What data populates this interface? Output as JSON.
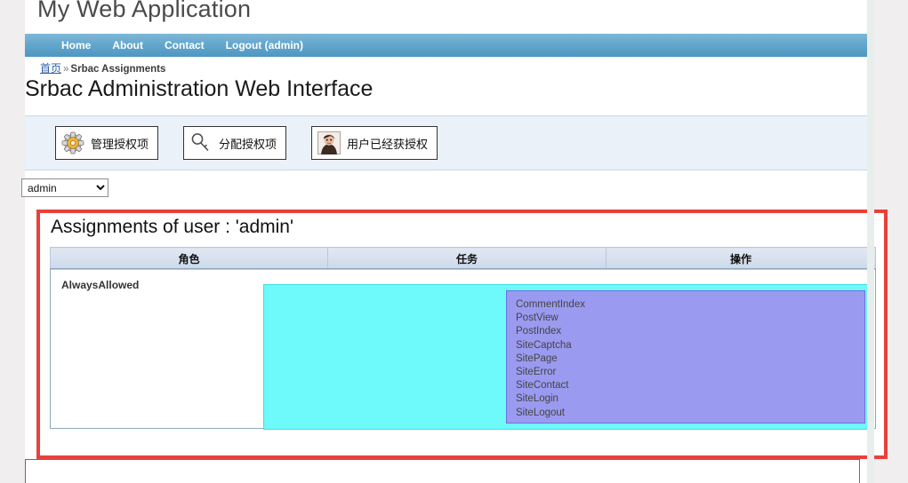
{
  "app": {
    "title": "My Web Application"
  },
  "nav": {
    "items": [
      {
        "label": "Home",
        "name": "nav-home"
      },
      {
        "label": "About",
        "name": "nav-about"
      },
      {
        "label": "Contact",
        "name": "nav-contact"
      },
      {
        "label": "Logout (admin)",
        "name": "nav-logout"
      }
    ]
  },
  "breadcrumb": {
    "home_label": "首页",
    "separator": "»",
    "current": "Srbac Assignments"
  },
  "page": {
    "heading": "Srbac Administration Web Interface"
  },
  "toolbar": {
    "buttons": [
      {
        "label": "管理授权项",
        "icon": "gear-icon"
      },
      {
        "label": "分配授权项",
        "icon": "key-icon"
      },
      {
        "label": "用户已经获授权",
        "icon": "user-photo-icon"
      }
    ]
  },
  "user_select": {
    "value": "admin",
    "options": [
      "admin"
    ]
  },
  "assignments": {
    "title": "Assignments of user : 'admin'",
    "columns": [
      "角色",
      "任务",
      "操作"
    ],
    "rows": [
      {
        "role": "AlwaysAllowed",
        "tasks": [
          "CommentIndex",
          "PostView",
          "PostIndex",
          "SiteCaptcha",
          "SitePage",
          "SiteError",
          "SiteContact",
          "SiteLogin",
          "SiteLogout"
        ]
      }
    ]
  },
  "colors": {
    "highlight_border": "#e8403c",
    "cyan_panel": "#6ef9fb",
    "purple_panel": "#9a9af0",
    "navbar": "#4e97c2"
  }
}
